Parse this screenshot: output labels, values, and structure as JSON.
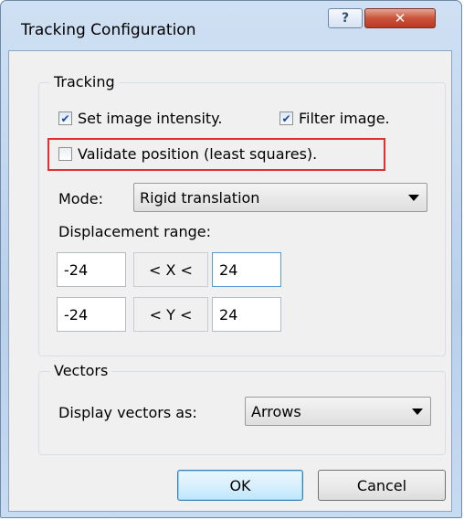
{
  "window": {
    "title": "Tracking Configuration",
    "help_label": "?",
    "close_label": "✕"
  },
  "tracking": {
    "legend": "Tracking",
    "set_intensity": {
      "label": "Set image intensity.",
      "checked": true
    },
    "filter_image": {
      "label": "Filter image.",
      "checked": true
    },
    "validate_position": {
      "label": "Validate position (least squares).",
      "checked": false
    },
    "mode_label": "Mode:",
    "mode_value": "Rigid translation",
    "displacement_label": "Displacement range:",
    "x_min": "-24",
    "x_op": "< X <",
    "x_max": "24",
    "y_min": "-24",
    "y_op": "< Y <",
    "y_max": "24"
  },
  "vectors": {
    "legend": "Vectors",
    "display_label": "Display vectors as:",
    "display_value": "Arrows"
  },
  "buttons": {
    "ok": "OK",
    "cancel": "Cancel"
  },
  "colors": {
    "highlight": "#e03030",
    "close_button": "#c9533b"
  }
}
